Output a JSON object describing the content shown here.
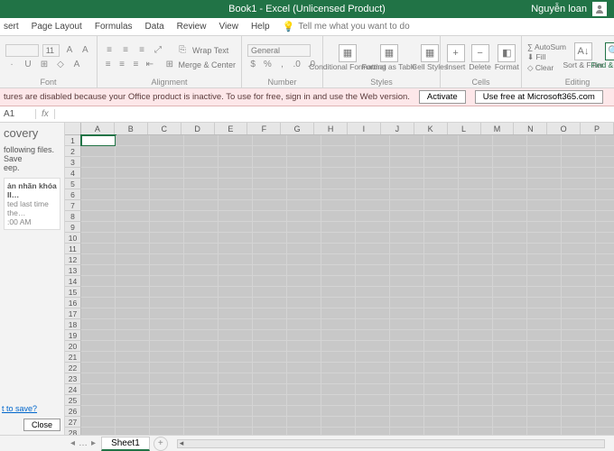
{
  "title": "Book1 - Excel (Unlicensed Product)",
  "user": "Nguyễn loan",
  "tabs": [
    "sert",
    "Page Layout",
    "Formulas",
    "Data",
    "Review",
    "View",
    "Help"
  ],
  "tellme": "Tell me what you want to do",
  "font": {
    "size": "11",
    "wrap": "Wrap Text",
    "merge": "Merge & Center"
  },
  "number_format": "General",
  "group_labels": {
    "font": "Font",
    "alignment": "Alignment",
    "number": "Number",
    "styles": "Styles",
    "cells": "Cells",
    "editing": "Editing"
  },
  "styles": {
    "cond": "Conditional\nFormatting",
    "table": "Format as\nTable",
    "cell": "Cell\nStyles"
  },
  "cells": {
    "insert": "Insert",
    "delete": "Delete",
    "format": "Format"
  },
  "editing": {
    "autosum": "AutoSum",
    "fill": "Fill",
    "clear": "Clear",
    "sort": "Sort &\nFilter",
    "find": "Find &\nSelect"
  },
  "warning": {
    "msg": "tures are disabled because your Office product is inactive. To use for free, sign in and use the Web version.",
    "activate": "Activate",
    "usefree": "Use free at Microsoft365.com"
  },
  "namebox": "A1",
  "fx": "fx",
  "recovery": {
    "title": "covery",
    "msg": "following files.  Save\neep.",
    "file_name": "ản nhãn khóa II…",
    "file_time": "ted last time the…\n:00 AM",
    "save_link": "t to save?",
    "close": "Close"
  },
  "columns": [
    "A",
    "B",
    "C",
    "D",
    "E",
    "F",
    "G",
    "H",
    "I",
    "J",
    "K",
    "L",
    "M",
    "N",
    "O",
    "P"
  ],
  "rowcount": 28,
  "sheet": "Sheet1"
}
